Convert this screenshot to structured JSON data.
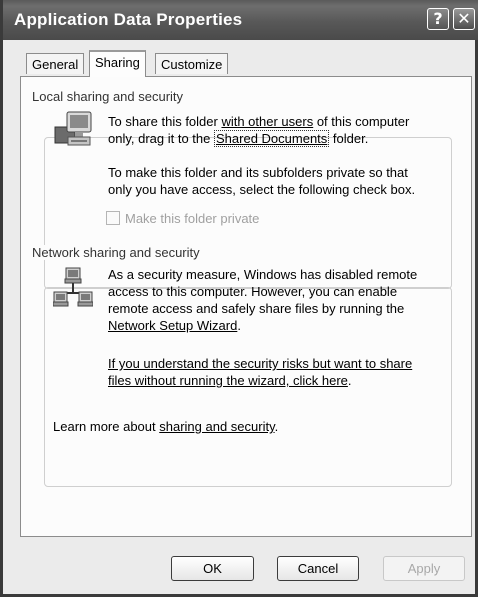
{
  "window": {
    "title": "Application Data Properties",
    "help_glyph": "?",
    "close_glyph": "✕"
  },
  "tabs": [
    {
      "label": "General",
      "active": false
    },
    {
      "label": "Sharing",
      "active": true
    },
    {
      "label": "Customize",
      "active": false
    }
  ],
  "local": {
    "legend": "Local sharing and security",
    "p1_pre": "To share this folder ",
    "p1_link": "with other users",
    "p1_mid": " of this computer",
    "p1_line2_pre": "only, drag it to the ",
    "p1_link2": "Shared Documents",
    "p1_post": " folder.",
    "p2_line1": "To make this folder and its subfolders private so that",
    "p2_line2": "only you have access, select the following check box.",
    "checkbox_label": "Make this folder private",
    "checkbox_checked": false,
    "checkbox_enabled": false
  },
  "network": {
    "legend": "Network sharing and security",
    "p1_line1": "As a security measure, Windows has disabled remote",
    "p1_line2": "access to this computer. However, you can enable",
    "p1_line3": "remote access and safely share files by running the",
    "wizard_link": "Network Setup Wizard",
    "wizard_after": ".",
    "risk_link_line1": "If you understand the security risks but want to share",
    "risk_link_line2": "files without running the wizard, click here",
    "risk_after": ".",
    "learn_pre": "Learn more about ",
    "learn_link": "sharing and security",
    "learn_post": "."
  },
  "buttons": {
    "ok": "OK",
    "cancel": "Cancel",
    "apply": "Apply"
  },
  "icons": {
    "local": "computer-folder-icon",
    "network": "network-computers-icon"
  }
}
